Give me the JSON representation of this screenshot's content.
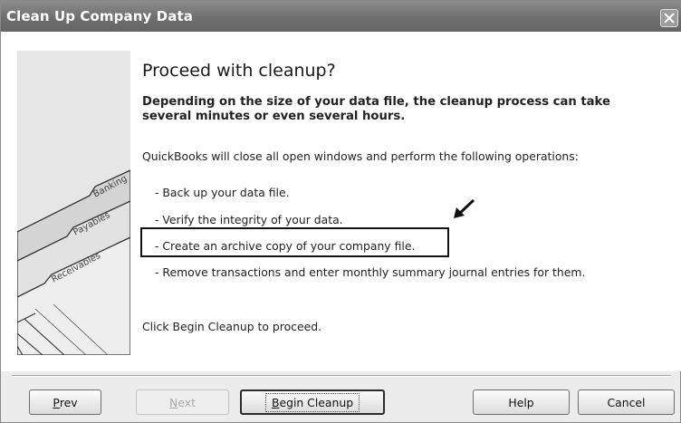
{
  "window": {
    "title": "Clean Up Company Data"
  },
  "main": {
    "heading": "Proceed with cleanup?",
    "subheading": "Depending on the size of your data file, the cleanup process can take several minutes or even several hours.",
    "intro": "QuickBooks will close all open windows and perform the following operations:",
    "operations": [
      "- Back up your data file.",
      "- Verify the integrity of your data.",
      "- Create an archive copy of your company file.",
      "- Remove transactions and enter monthly summary journal entries for them."
    ],
    "proceed_text": "Click Begin Cleanup to proceed."
  },
  "illustration": {
    "tabs": [
      "Banking",
      "Payables",
      "Receivables"
    ]
  },
  "buttons": {
    "prev": {
      "mnemonic": "P",
      "rest": "rev"
    },
    "next": {
      "mnemonic": "N",
      "rest": "ext"
    },
    "begin": {
      "mnemonic": "B",
      "rest": "egin Cleanup"
    },
    "help": "Help",
    "cancel": "Cancel"
  }
}
